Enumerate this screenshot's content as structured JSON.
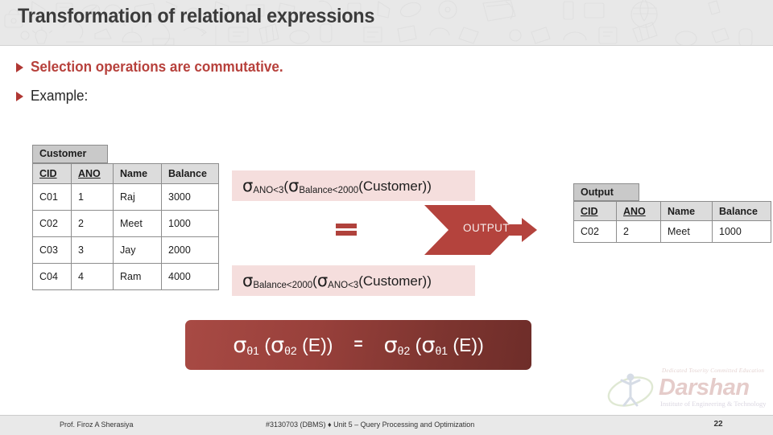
{
  "header": {
    "title": "Transformation of relational expressions"
  },
  "bullets": [
    {
      "text": "Selection operations are commutative.",
      "icon": "triangle-bullet-icon"
    },
    {
      "text": "Example:",
      "icon": "triangle-bullet-icon"
    }
  ],
  "customer_table": {
    "caption": "Customer",
    "columns": [
      "CID",
      "ANO",
      "Name",
      "Balance"
    ],
    "key_columns": [
      "CID",
      "ANO"
    ],
    "rows": [
      [
        "C01",
        "1",
        "Raj",
        "3000"
      ],
      [
        "C02",
        "2",
        "Meet",
        "1000"
      ],
      [
        "C03",
        "3",
        "Jay",
        "2000"
      ],
      [
        "C04",
        "4",
        "Ram",
        "4000"
      ]
    ]
  },
  "output_table": {
    "caption": "Output",
    "columns": [
      "CID",
      "ANO",
      "Name",
      "Balance"
    ],
    "key_columns": [
      "CID",
      "ANO"
    ],
    "rows": [
      [
        "C02",
        "2",
        "Meet",
        "1000"
      ]
    ]
  },
  "expressions": {
    "top": {
      "outer_op": "σ",
      "outer_sub": "ANO<3",
      "inner_op": "σ",
      "inner_sub": "Balance<2000",
      "operand": "(Customer))",
      "open": "("
    },
    "bottom": {
      "outer_op": "σ",
      "outer_sub": "Balance<2000",
      "inner_op": "σ",
      "inner_sub": "ANO<3",
      "operand": "(Customer))",
      "open": "("
    },
    "equals": "="
  },
  "arrow": {
    "label": "OUTPUT"
  },
  "rule_box": {
    "left_op": "σ",
    "left_sub": "θ1",
    "left_open": "(",
    "left_inner_op": "σ",
    "left_inner_sub": "θ2",
    "left_tail": "(E))",
    "equals": "=",
    "right_op": "σ",
    "right_sub": "θ2",
    "right_open": "(",
    "right_inner_op": "σ",
    "right_inner_sub": "θ1",
    "right_tail": "(E))"
  },
  "logo": {
    "tagline": "Dedicated Toserity Committed Education",
    "name": "Darshan",
    "sub": "Institute of Engineering & Technology"
  },
  "footer": {
    "author": "Prof. Firoz A Sherasiya",
    "center": "#3130703 (DBMS)  ♦  Unit 5 – Query Processing and Optimization",
    "page": "22"
  },
  "colors": {
    "accent_red": "#b4433d",
    "title_gray": "#3b3b3b",
    "pink_box": "#f5dedd",
    "header_bg": "#e8e8e8"
  }
}
